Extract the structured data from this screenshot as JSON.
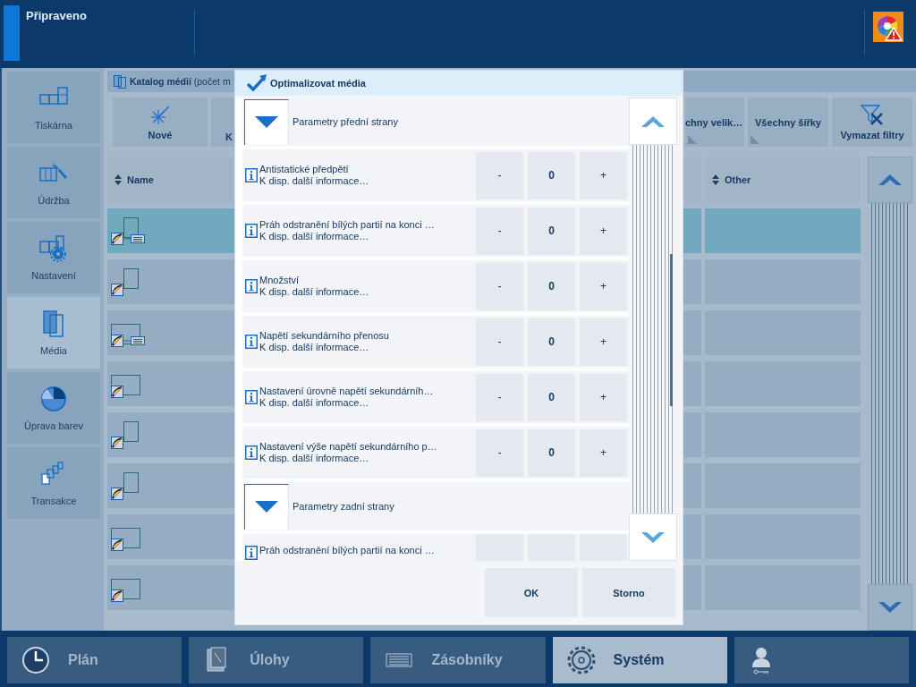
{
  "header": {
    "status": "Připraveno"
  },
  "sidebar": {
    "items": [
      {
        "kind": "printer",
        "label": "Tiskárna",
        "selected": false
      },
      {
        "kind": "maintenance",
        "label": "Údržba",
        "selected": false
      },
      {
        "kind": "settings",
        "label": "Nastavení",
        "selected": false
      },
      {
        "kind": "media",
        "label": "Média",
        "selected": true
      },
      {
        "kind": "color",
        "label": "Úprava barev",
        "selected": false
      },
      {
        "kind": "transactions",
        "label": "Transakce",
        "selected": false
      }
    ]
  },
  "catalog": {
    "title": "**Katalog médií** (počet m"
  },
  "toolbar": [
    {
      "kind": "new",
      "label": "Nové"
    },
    {
      "kind": "cut",
      "label": "K"
    },
    {
      "kind": "cut-end",
      "label": "chny velik…"
    },
    {
      "kind": "filter",
      "label": "Všechny šířky"
    },
    {
      "kind": "clear",
      "label": "Vymazat filtry"
    }
  ],
  "table": {
    "columns": [
      {
        "label": "Name"
      },
      {
        "label": "Other"
      }
    ],
    "rows": [
      {
        "kind": "portrait",
        "listed": true,
        "selected": true
      },
      {
        "kind": "portrait",
        "listed": false,
        "selected": false
      },
      {
        "kind": "landscape",
        "listed": true,
        "selected": false
      },
      {
        "kind": "landscape",
        "listed": false,
        "selected": false
      },
      {
        "kind": "portrait",
        "listed": false,
        "selected": false
      },
      {
        "kind": "portrait",
        "listed": false,
        "selected": false
      },
      {
        "kind": "landscape",
        "listed": false,
        "selected": false
      },
      {
        "kind": "landscape",
        "listed": false,
        "selected": false
      }
    ]
  },
  "dialog": {
    "title": "Optimalizovat média",
    "items": [
      {
        "kind": "section",
        "label": "Parametry přední strany"
      },
      {
        "kind": "param",
        "label": "Antistatické předpětí",
        "hint": "K disp. další informace…",
        "minus": "-",
        "value": "0",
        "plus": "+"
      },
      {
        "kind": "param",
        "label": "Práh odstranění bílých partií na konci …",
        "hint": "K disp. další informace…",
        "minus": "-",
        "value": "0",
        "plus": "+"
      },
      {
        "kind": "param",
        "label": "Množství",
        "hint": "K disp. další informace…",
        "minus": "-",
        "value": "0",
        "plus": "+"
      },
      {
        "kind": "param",
        "label": "Napětí sekundárního přenosu",
        "hint": "K disp. další informace…",
        "minus": "-",
        "value": "0",
        "plus": "+"
      },
      {
        "kind": "param",
        "label": "Nastavení úrovně napětí sekundárníh…",
        "hint": "K disp. další informace…",
        "minus": "-",
        "value": "0",
        "plus": "+"
      },
      {
        "kind": "param",
        "label": "Nastavení výše napětí sekundárního p…",
        "hint": "K disp. další informace…",
        "minus": "-",
        "value": "0",
        "plus": "+"
      },
      {
        "kind": "section",
        "label": "Parametry zadní strany"
      },
      {
        "kind": "param",
        "label": "Práh odstranění bílých partií na konci …"
      }
    ],
    "buttons": [
      "OK",
      "Storno"
    ]
  },
  "nav": [
    {
      "kind": "clock",
      "label": "Plán",
      "selected": false
    },
    {
      "kind": "jobs",
      "label": "Úlohy",
      "selected": false
    },
    {
      "kind": "trays",
      "label": "Zásobníky",
      "selected": false
    },
    {
      "kind": "gear",
      "label": "Systém",
      "selected": true
    },
    {
      "kind": "user",
      "selected": false
    }
  ]
}
